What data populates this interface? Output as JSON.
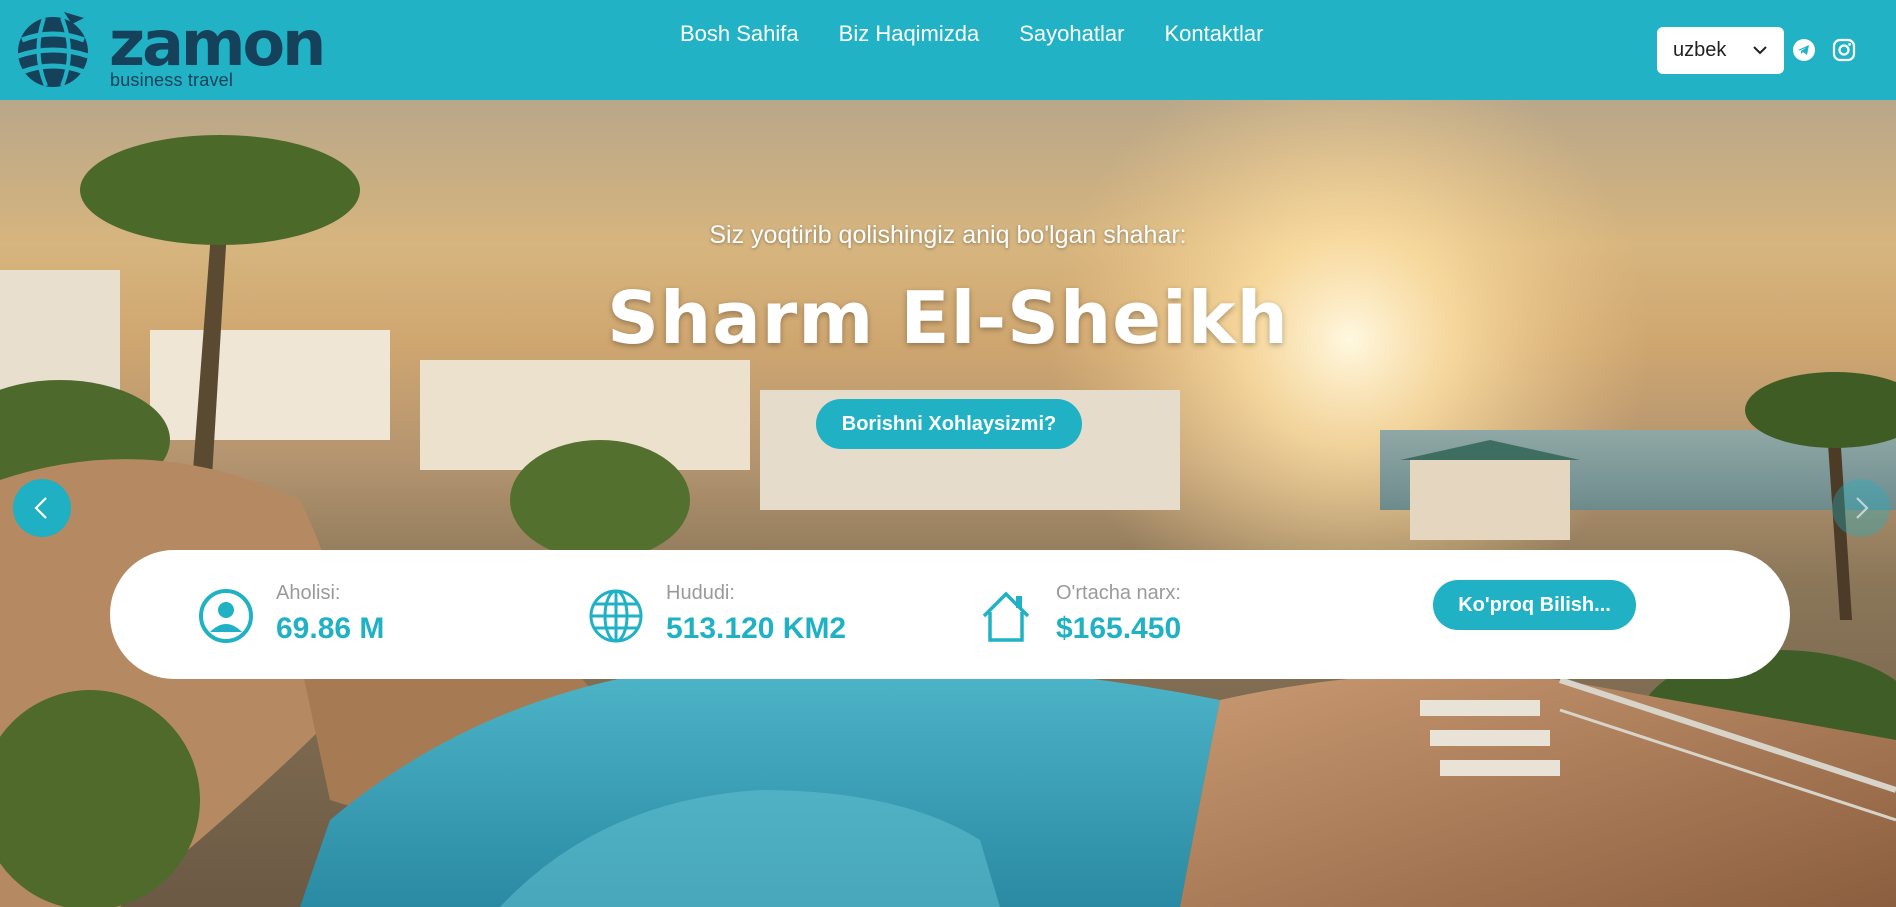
{
  "brand": {
    "name": "zamon",
    "tagline": "business travel",
    "color": "#15425a"
  },
  "nav": {
    "items": [
      {
        "label": "Bosh Sahifa"
      },
      {
        "label": "Biz Haqimizda"
      },
      {
        "label": "Sayohatlar"
      },
      {
        "label": "Kontaktlar"
      }
    ]
  },
  "language": {
    "selected": "uzbek"
  },
  "social": {
    "icons": [
      "telegram-icon",
      "instagram-icon"
    ]
  },
  "hero": {
    "subtitle": "Siz yoqtirib qolishingiz aniq bo'lgan shahar:",
    "city": "Sharm El-Sheikh",
    "cta": "Borishni Xohlaysizmi?"
  },
  "stats": [
    {
      "icon": "user-icon",
      "label": "Aholisi:",
      "value": "69.86 M"
    },
    {
      "icon": "globe-icon",
      "label": "Hududi:",
      "value": "513.120 KM2"
    },
    {
      "icon": "home-icon",
      "label": "O'rtacha narx:",
      "value": "$165.450"
    }
  ],
  "card_button": "Ko'proq Bilish...",
  "colors": {
    "accent": "#20b2c4",
    "header": "#22b2c5",
    "text_muted": "#9a9a9a"
  }
}
